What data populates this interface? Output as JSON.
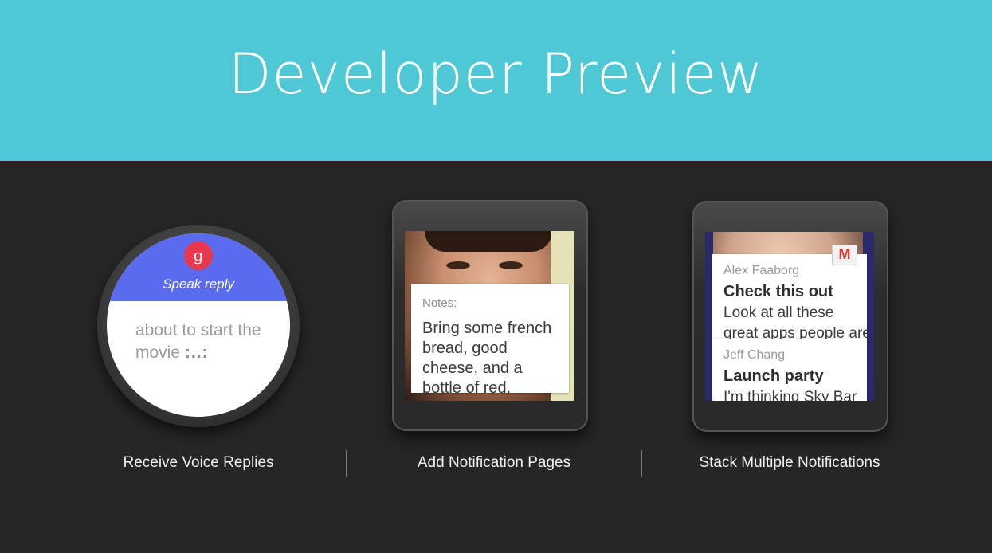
{
  "header": {
    "title": "Developer Preview"
  },
  "features": [
    {
      "caption": "Receive Voice Replies",
      "badge": "g",
      "prompt": "Speak reply",
      "reply_text": "about to start the movie",
      "reply_dots": ":..:"
    },
    {
      "caption": "Add Notification Pages",
      "card": {
        "label": "Notes:",
        "body": "Bring some french bread, good cheese, and a bottle of red."
      }
    },
    {
      "caption": "Stack Multiple Notifications",
      "badge": "M",
      "notifications": [
        {
          "sender": "Alex Faaborg",
          "title": "Check this out",
          "body_line1": "Look at all these",
          "body_line2": "great apps people are"
        },
        {
          "sender": "Jeff Chang",
          "title": "Launch party",
          "body_line1": "I'm thinking Sky Bar"
        }
      ]
    }
  ],
  "colors": {
    "header_bg": "#4ec8d4",
    "stage_bg": "#262626",
    "reply_bar": "#5b6bf0",
    "badge_red": "#e8364c"
  }
}
